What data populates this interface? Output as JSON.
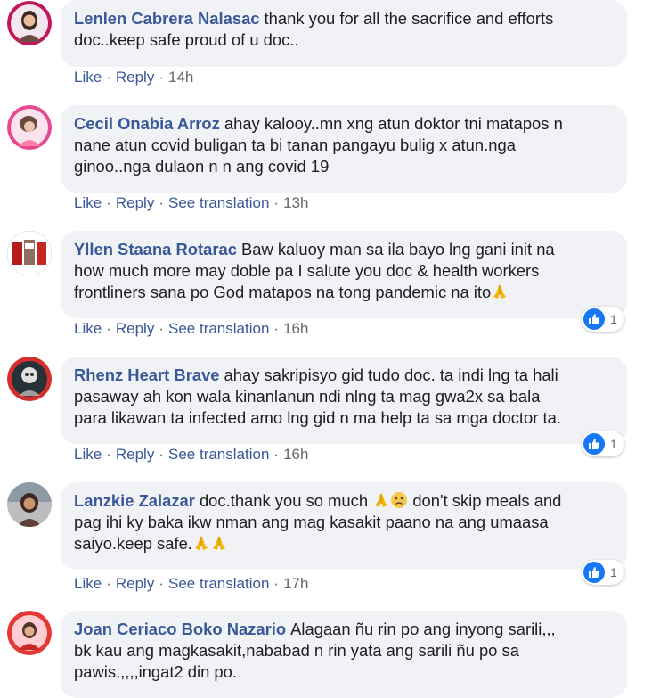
{
  "comments": [
    {
      "author": "Lenlen Cabrera Nalasac",
      "line1": "thank you for all the sacrifice and efforts",
      "line2": "doc..keep safe proud of u doc..",
      "actions": {
        "like": "Like",
        "reply": "Reply",
        "time": "14h"
      }
    },
    {
      "author": "Cecil Onabia Arroz",
      "line1": "ahay kalooy..mn xng atun doktor tni matapos n",
      "line2": "nane atun covid buligan ta bi tanan pangayu bulig x atun.nga",
      "line3": "ginoo..nga dulaon n n ang covid 19",
      "actions": {
        "like": "Like",
        "reply": "Reply",
        "see_translation": "See translation",
        "time": "13h"
      }
    },
    {
      "author": "Yllen Staana Rotarac",
      "line1": "Baw kaluoy man sa ila bayo lng gani init na",
      "line2": "how much more may doble pa I salute you doc & health workers",
      "line3": "frontliners sana po God matapos na tong pandemic na ito",
      "actions": {
        "like": "Like",
        "reply": "Reply",
        "see_translation": "See translation",
        "time": "16h"
      },
      "reaction_count": "1"
    },
    {
      "author": "Rhenz Heart Brave",
      "line1": "ahay sakripisyo gid tudo doc. ta indi lng ta hali",
      "line2": "pasaway ah kon wala kinanlanun ndi nlng ta mag gwa2x sa bala",
      "line3": "para likawan ta infected amo lng gid n ma help ta sa mga doctor ta.",
      "actions": {
        "like": "Like",
        "reply": "Reply",
        "see_translation": "See translation",
        "time": "16h"
      },
      "reaction_count": "1"
    },
    {
      "author": "Lanzkie Zalazar",
      "line1a": "doc.thank you so much",
      "line1b": "don't skip meals and",
      "line2": "pag ihi ky baka ikw nman ang mag kasakit paano na ang umaasa",
      "line3": "saiyo.keep safe.",
      "actions": {
        "like": "Like",
        "reply": "Reply",
        "see_translation": "See translation",
        "time": "17h"
      },
      "reaction_count": "1"
    },
    {
      "author": "Joan Ceriaco Boko Nazario",
      "line1": "Alagaan ñu rin po ang inyong sarili,,,",
      "line2": "bk kau ang magkasakit,nababad n rin yata ang sarili ñu po sa",
      "line3": "pawis,,,,,ingat2 din po."
    }
  ],
  "colors": {
    "author": "#385898",
    "bubble": "#f0f2f5",
    "text": "#1c1e21",
    "meta_gray": "#65676b",
    "like_blue": "#1877f2"
  },
  "icons": {
    "reaction": "like-thumb-icon",
    "emoji_pray": "folded-hands-emoji-icon",
    "emoji_sad": "sad-face-emoji-icon"
  }
}
